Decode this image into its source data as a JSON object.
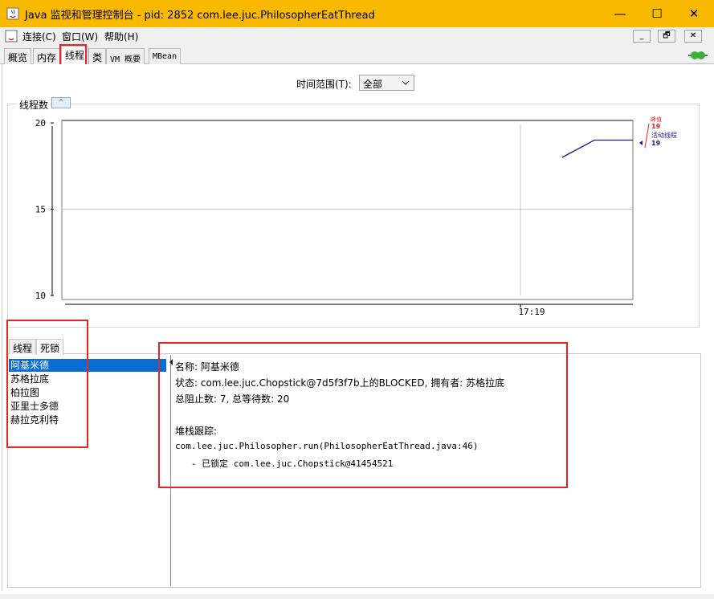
{
  "window": {
    "title": "Java 监视和管理控制台 - pid: 2852 com.lee.juc.PhilosopherEatThread",
    "controls": {
      "minimize": "—",
      "maximize": "☐",
      "close": "✕"
    }
  },
  "menubar": {
    "items": [
      "连接(C)",
      "窗口(W)",
      "帮助(H)"
    ],
    "mdi": {
      "minimize": "_",
      "restore": "🗗",
      "close": "✕"
    }
  },
  "tabs": [
    {
      "label": "概览"
    },
    {
      "label": "内存"
    },
    {
      "label": "线程"
    },
    {
      "label": "类"
    },
    {
      "label": "VM 概要"
    },
    {
      "label": "MBean"
    }
  ],
  "selected_tab": "线程",
  "time_range": {
    "label": "时间范围(T):",
    "value": "全部"
  },
  "chart_panel": {
    "title": "线程数",
    "collapse_icon": "double-chevron-up-icon"
  },
  "chart_data": {
    "type": "line",
    "ylim": [
      10,
      20
    ],
    "y_ticks": [
      "20",
      "15",
      "10"
    ],
    "x_ticks": [
      "17:19"
    ],
    "series": [
      {
        "name": "峰值",
        "color": "#e3242b",
        "current": "19"
      },
      {
        "name": "活动线程",
        "color": "#1b1b8a",
        "current": "19",
        "values": [
          18,
          19,
          19
        ]
      }
    ]
  },
  "lower_tabs": [
    {
      "label": "线程"
    },
    {
      "label": "死锁"
    }
  ],
  "deadlock_threads": [
    "阿基米德",
    "苏格拉底",
    "柏拉图",
    "亚里士多德",
    "赫拉克利特"
  ],
  "detail": {
    "name_line": "名称: 阿基米德",
    "state_line": "状态: com.lee.juc.Chopstick@7d5f3f7b上的BLOCKED, 拥有者: 苏格拉底",
    "counts_line": "总阻止数: 7, 总等待数: 20",
    "stack_header": "堆栈跟踪:",
    "stack_line1": "com.lee.juc.Philosopher.run(PhilosopherEatThread.java:46)",
    "stack_line2": "   - 已锁定 com.lee.juc.Chopstick@41454521"
  },
  "colors": {
    "titlebar": "#f9b900",
    "highlight": "#e3242b",
    "selection": "#0a6dd1"
  }
}
